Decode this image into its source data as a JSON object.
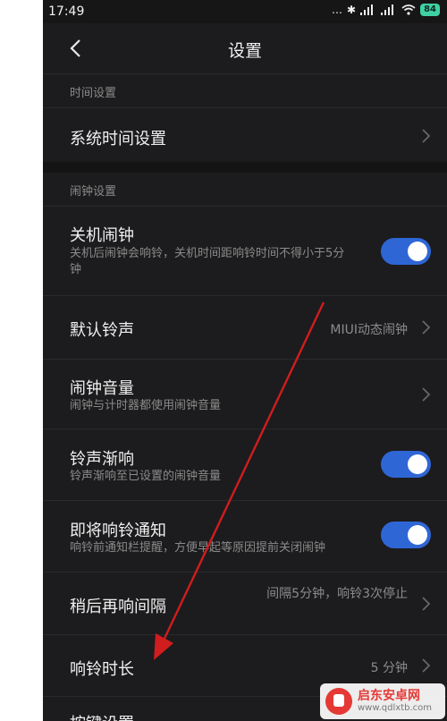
{
  "status_bar": {
    "time": "17:49",
    "signal": "…",
    "bluetooth": "✱",
    "battery": "84"
  },
  "header": {
    "title": "设置"
  },
  "sections": {
    "time": {
      "label": "时间设置"
    },
    "alarm": {
      "label": "闹钟设置"
    }
  },
  "rows": {
    "system_time": {
      "label": "系统时间设置"
    },
    "poweroff_alarm": {
      "label": "关机闹钟",
      "sub": "关机后闹钟会响铃，关机时间距响铃时间不得小于5分钟",
      "enabled": true
    },
    "default_ringtone": {
      "label": "默认铃声",
      "value": "MIUI动态闹钟"
    },
    "alarm_volume": {
      "label": "闹钟音量",
      "sub": "闹钟与计时器都使用闹钟音量"
    },
    "fade_in": {
      "label": "铃声渐响",
      "sub": "铃声渐响至已设置的闹钟音量",
      "enabled": true
    },
    "upcoming_notice": {
      "label": "即将响铃通知",
      "sub": "响铃前通知栏提醒，方便早起等原因提前关闭闹钟",
      "enabled": true
    },
    "snooze_interval": {
      "label": "稍后再响间隔",
      "value": "间隔5分钟，响铃3次停止"
    },
    "ring_duration": {
      "label": "响铃时长",
      "value": "5 分钟"
    },
    "button_settings": {
      "label": "按键设置"
    }
  },
  "watermark": {
    "name": "启东安卓网",
    "url": "www.qdlxtb.com"
  },
  "colors": {
    "toggle_on": "#2f66d6",
    "annotation_arrow": "#d01d1d",
    "background": "#1c1c1e"
  }
}
